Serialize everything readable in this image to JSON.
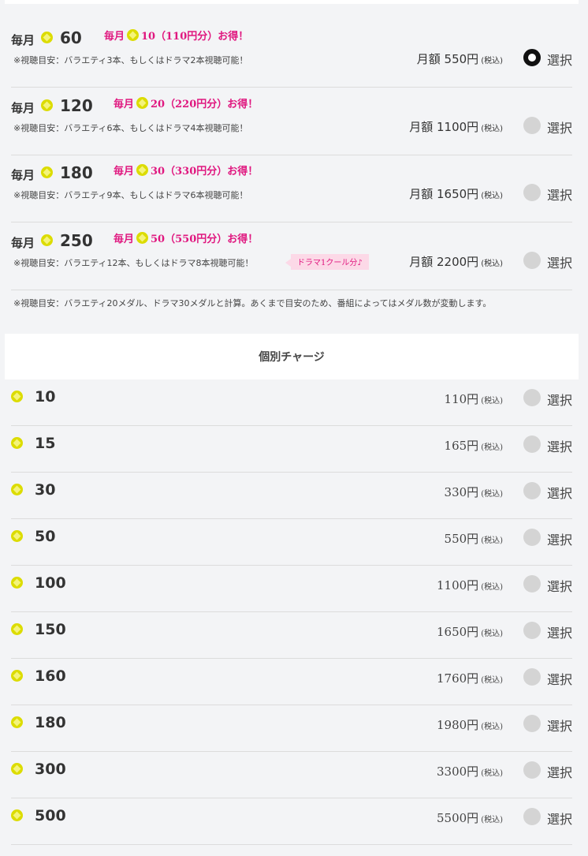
{
  "colors": {
    "accent": "#e0177f",
    "coin": "#dcdc00",
    "radio_off": "#d4d4d4",
    "radio_on": "#111111"
  },
  "plans": [
    {
      "monthly": "毎月",
      "amount": "60",
      "bonus_prefix": "毎月",
      "bonus_text": "10（110円分）お得！",
      "note": "※視聴目安：バラエティ3本、もしくはドラマ2本視聴可能！",
      "price": "月額 550円",
      "tax": "(税込)",
      "select": "選択",
      "selected": true
    },
    {
      "monthly": "毎月",
      "amount": "120",
      "bonus_prefix": "毎月",
      "bonus_text": "20（220円分）お得！",
      "note": "※視聴目安：バラエティ6本、もしくはドラマ4本視聴可能！",
      "price": "月額 1100円",
      "tax": "(税込)",
      "select": "選択",
      "selected": false
    },
    {
      "monthly": "毎月",
      "amount": "180",
      "bonus_prefix": "毎月",
      "bonus_text": "30（330円分）お得！",
      "note": "※視聴目安：バラエティ9本、もしくはドラマ6本視聴可能！",
      "price": "月額 1650円",
      "tax": "(税込)",
      "select": "選択",
      "selected": false
    },
    {
      "monthly": "毎月",
      "amount": "250",
      "bonus_prefix": "毎月",
      "bonus_text": "50（550円分）お得！",
      "note": "※視聴目安：バラエティ12本、もしくはドラマ8本視聴可能！",
      "tag": "ドラマ1クール分♪",
      "price": "月額 2200円",
      "tax": "(税込)",
      "select": "選択",
      "selected": false
    }
  ],
  "disclaimer": "※視聴目安：バラエティ20メダル、ドラマ30メダルと計算。あくまで目安のため、番組によってはメダル数が変動します。",
  "section_title": "個別チャージ",
  "charges": [
    {
      "amount": "10",
      "price": "110円",
      "tax": "(税込)",
      "select": "選択"
    },
    {
      "amount": "15",
      "price": "165円",
      "tax": "(税込)",
      "select": "選択"
    },
    {
      "amount": "30",
      "price": "330円",
      "tax": "(税込)",
      "select": "選択"
    },
    {
      "amount": "50",
      "price": "550円",
      "tax": "(税込)",
      "select": "選択"
    },
    {
      "amount": "100",
      "price": "1100円",
      "tax": "(税込)",
      "select": "選択"
    },
    {
      "amount": "150",
      "price": "1650円",
      "tax": "(税込)",
      "select": "選択"
    },
    {
      "amount": "160",
      "price": "1760円",
      "tax": "(税込)",
      "select": "選択"
    },
    {
      "amount": "180",
      "price": "1980円",
      "tax": "(税込)",
      "select": "選択"
    },
    {
      "amount": "300",
      "price": "3300円",
      "tax": "(税込)",
      "select": "選択"
    },
    {
      "amount": "500",
      "price": "5500円",
      "tax": "(税込)",
      "select": "選択"
    }
  ]
}
